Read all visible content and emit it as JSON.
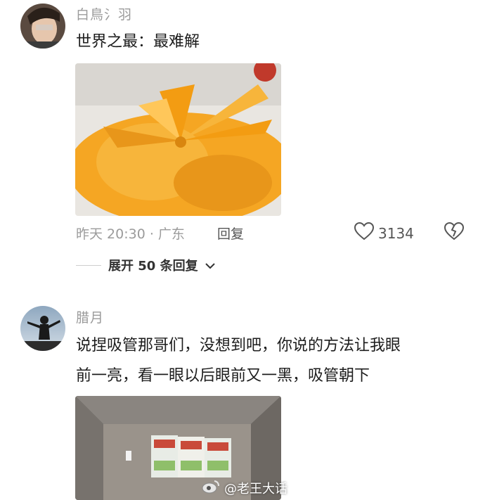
{
  "comments": [
    {
      "username": "白鳥氵羽",
      "text": "世界之最：最难解",
      "time": "昨天 20:30",
      "location": "广东",
      "reply_label": "回复",
      "likes": "3134",
      "expand_label": "展开 50 条回复"
    },
    {
      "username": "腊月",
      "text_line1": "说捏吸管那哥们，没想到吧，你说的方法让我眼",
      "text_line2": "前一亮，看一眼以后眼前又一黑，吸管朝下"
    }
  ],
  "watermark": "@老王大话",
  "colors": {
    "meta": "#9b9b9b",
    "bag": "#f5a623"
  }
}
